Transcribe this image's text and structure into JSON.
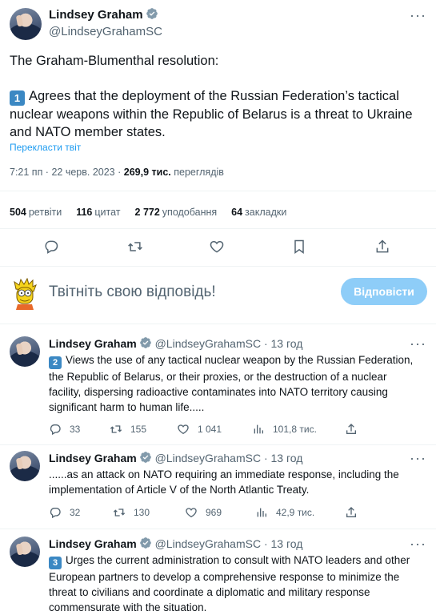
{
  "tweet": {
    "author_name": "Lindsey Graham",
    "author_handle": "@LindseyGrahamSC",
    "line1": "The Graham-Blumenthal resolution:",
    "item1_number": "1",
    "item1_text": "Agrees that the deployment of the Russian Federation’s tactical nuclear weapons within the Republic of Belarus is a threat to Ukraine and NATO member states.",
    "translate_label": "Перекласти твіт",
    "time": "7:21 пп · 22 черв. 2023 ·",
    "views_count": "269,9 тис.",
    "views_label": "переглядів"
  },
  "stats": {
    "retweets_count": "504",
    "retweets_label": "ретвіти",
    "quotes_count": "116",
    "quotes_label": "цитат",
    "likes_count": "2 772",
    "likes_label": "уподобання",
    "bookmarks_count": "64",
    "bookmarks_label": "закладки"
  },
  "composer": {
    "placeholder": "Твітніть свою відповідь!",
    "reply_label": "Відповісти"
  },
  "replies": [
    {
      "name": "Lindsey Graham",
      "handle": "@LindseyGrahamSC · 13 год",
      "number": "2",
      "text": "Views the use of any tactical nuclear weapon by the Russian Federation, the Republic of Belarus, or their proxies, or the destruction of a nuclear facility,      dispersing radioactive contaminates into NATO territory causing significant harm to human life.....",
      "replies": "33",
      "retweets": "155",
      "likes": "1 041",
      "views": "101,8 тис."
    },
    {
      "name": "Lindsey Graham",
      "handle": "@LindseyGrahamSC · 13 год",
      "text": "......as an attack on NATO requiring an immediate response, including the implementation of Article V of the North Atlantic Treaty.",
      "replies": "32",
      "retweets": "130",
      "likes": "969",
      "views": "42,9 тис."
    },
    {
      "name": "Lindsey Graham",
      "handle": "@LindseyGrahamSC · 13 год",
      "number": "3",
      "text": "Urges the current administration to consult with NATO leaders and other European partners to develop a comprehensive response to minimize the threat to civilians and coordinate a diplomatic and military response commensurate with the situation."
    }
  ],
  "icons": {
    "verified": "verified-badge-icon",
    "more": "more-dots-icon",
    "reply": "reply-icon",
    "retweet": "retweet-icon",
    "like": "heart-icon",
    "bookmark": "bookmark-icon",
    "share": "share-icon",
    "views": "views-chart-icon"
  },
  "colors": {
    "accent": "#1d9bf0",
    "reply_button": "#8ecdf8",
    "keycap": "#3b88c3",
    "secondary_text": "#536471"
  }
}
